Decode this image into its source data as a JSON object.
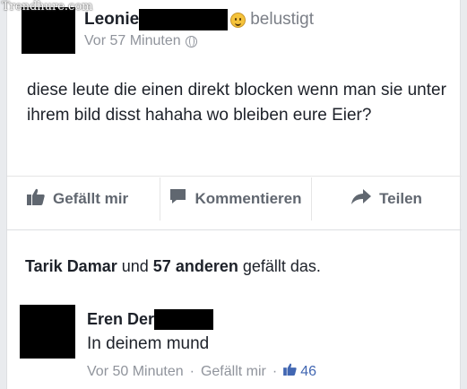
{
  "watermark": "Trendhure.com",
  "post": {
    "author": "Leonie",
    "feeling": "belustigt",
    "time": "Vor 57 Minuten",
    "text": "diese leute die einen direkt blocken wenn man sie unter ihrem bild disst hahaha wo bleiben eure Eier?"
  },
  "actions": {
    "like_label": "Gefällt mir",
    "comment_label": "Kommentieren",
    "share_label": "Teilen"
  },
  "likes": {
    "name": "Tarik Damar",
    "connector": "und",
    "others": "57 anderen",
    "suffix": "gefällt das."
  },
  "comment": {
    "author": "Eren Der",
    "text": "In deinem mund",
    "time": "Vor 50 Minuten",
    "separator": "·",
    "like_label": "Gefällt mir",
    "like_count": "46"
  },
  "colors": {
    "text": "#1d2129",
    "muted": "#90949c",
    "action": "#616770",
    "link_blue": "#4267b2"
  },
  "icons": {
    "feeling": "smiley-emoji-icon",
    "privacy": "globe-icon",
    "like": "thumbs-up-icon",
    "comment": "speech-bubble-icon",
    "share": "share-arrow-icon"
  }
}
